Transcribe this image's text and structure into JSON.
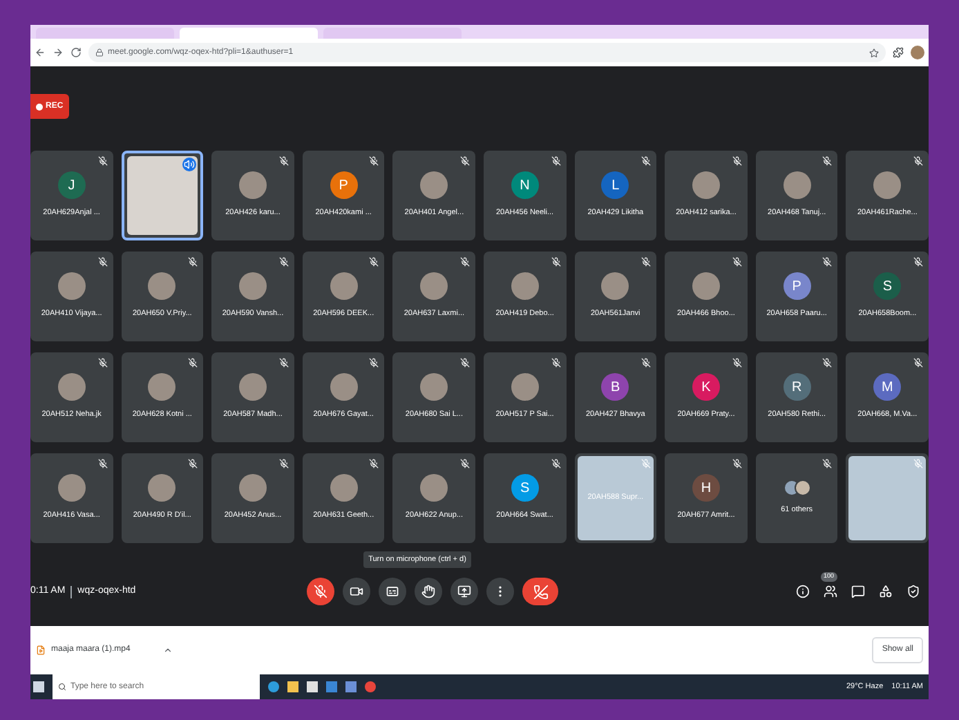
{
  "browser": {
    "tabs": [
      {
        "selected": false
      },
      {
        "selected": true
      },
      {
        "selected": false
      }
    ],
    "url": "meet.google.com/wqz-oqex-htd?pli=1&authuser=1"
  },
  "meeting": {
    "recording_badge": "REC",
    "tiles": [
      {
        "kind": "letter",
        "letter": "J",
        "color": "#1e6b52",
        "name": "20AH629Anjal ...",
        "speaking": false
      },
      {
        "kind": "video",
        "speaking": true
      },
      {
        "kind": "photo",
        "name": "20AH426 karu...",
        "speaking": false
      },
      {
        "kind": "letter",
        "letter": "P",
        "color": "#e8710a",
        "name": "20AH420kami ...",
        "speaking": false
      },
      {
        "kind": "photo",
        "name": "20AH401 Angel...",
        "speaking": false
      },
      {
        "kind": "letter",
        "letter": "N",
        "color": "#00897b",
        "name": "20AH456 Neeli...",
        "speaking": false
      },
      {
        "kind": "letter",
        "letter": "L",
        "color": "#1565c0",
        "name": "20AH429 Likitha",
        "speaking": false
      },
      {
        "kind": "photo",
        "name": "20AH412 sarika...",
        "speaking": false
      },
      {
        "kind": "photo",
        "name": "20AH468 Tanuj...",
        "speaking": false
      },
      {
        "kind": "photo",
        "name": "20AH461Rache...",
        "speaking": false
      },
      {
        "kind": "photo",
        "name": "20AH410 Vijaya...",
        "speaking": false
      },
      {
        "kind": "photo",
        "name": "20AH650 V.Priy...",
        "speaking": false
      },
      {
        "kind": "photo",
        "name": "20AH590 Vansh...",
        "speaking": false
      },
      {
        "kind": "photo",
        "name": "20AH596 DEEK...",
        "speaking": false
      },
      {
        "kind": "photo",
        "name": "20AH637 Laxmi...",
        "speaking": false
      },
      {
        "kind": "photo",
        "name": "20AH419 Debo...",
        "speaking": false
      },
      {
        "kind": "photo",
        "name": "20AH561Janvi",
        "speaking": false
      },
      {
        "kind": "photo",
        "name": "20AH466 Bhoo...",
        "speaking": false
      },
      {
        "kind": "letter",
        "letter": "P",
        "color": "#7986cb",
        "name": "20AH658 Paaru...",
        "speaking": false
      },
      {
        "kind": "letter",
        "letter": "S",
        "color": "#1b5e4a",
        "name": "20AH658Boom...",
        "speaking": false
      },
      {
        "kind": "photo",
        "name": "20AH512 Neha.jk",
        "speaking": false
      },
      {
        "kind": "photo",
        "name": "20AH628 Kotni ...",
        "speaking": false
      },
      {
        "kind": "photo",
        "name": "20AH587 Madh...",
        "speaking": false
      },
      {
        "kind": "photo",
        "name": "20AH676 Gayat...",
        "speaking": false
      },
      {
        "kind": "photo",
        "name": "20AH680 Sai L...",
        "speaking": false
      },
      {
        "kind": "photo",
        "name": "20AH517 P Sai...",
        "speaking": false
      },
      {
        "kind": "letter",
        "letter": "B",
        "color": "#8e44ad",
        "name": "20AH427 Bhavya",
        "speaking": false
      },
      {
        "kind": "letter",
        "letter": "K",
        "color": "#d81b60",
        "name": "20AH669 Praty...",
        "speaking": false
      },
      {
        "kind": "letter",
        "letter": "R",
        "color": "#546e7a",
        "name": "20AH580 Rethi...",
        "speaking": false
      },
      {
        "kind": "letter",
        "letter": "M",
        "color": "#5c6bc0",
        "name": "20AH668, M.Va...",
        "speaking": false
      },
      {
        "kind": "photo",
        "name": "20AH416 Vasa...",
        "speaking": false
      },
      {
        "kind": "photo",
        "name": "20AH490 R D'il...",
        "speaking": false
      },
      {
        "kind": "photo",
        "name": "20AH452 Anus...",
        "speaking": false
      },
      {
        "kind": "photo",
        "name": "20AH631 Geeth...",
        "speaking": false
      },
      {
        "kind": "photo",
        "name": "20AH622 Anup...",
        "speaking": false
      },
      {
        "kind": "letter",
        "letter": "S",
        "color": "#039be5",
        "name": "20AH664 Swat...",
        "speaking": false
      },
      {
        "kind": "video",
        "name": "20AH588 Supr...",
        "speaking": false
      },
      {
        "kind": "letter",
        "letter": "H",
        "color": "#6d4c41",
        "name": "20AH677 Amrit...",
        "speaking": false
      },
      {
        "kind": "others",
        "name": "61 others",
        "speaking": false
      },
      {
        "kind": "video",
        "speaking": false
      }
    ],
    "time": "0:11 AM",
    "meeting_code": "wqz-oqex-htd",
    "tooltip": "Turn on microphone (ctrl + d)",
    "controls": [
      {
        "kind": "mic",
        "on": false
      },
      {
        "kind": "camera",
        "on": true
      },
      {
        "kind": "captions"
      },
      {
        "kind": "hand"
      },
      {
        "kind": "present"
      },
      {
        "kind": "more"
      },
      {
        "kind": "hangup"
      }
    ],
    "participants_count": "100"
  },
  "download_bar": {
    "file": "maaja maara (1).mp4",
    "show_all": "Show all"
  },
  "taskbar": {
    "search_placeholder": "Type here to search",
    "weather": "29°C Haze",
    "time": "10:11 AM"
  }
}
